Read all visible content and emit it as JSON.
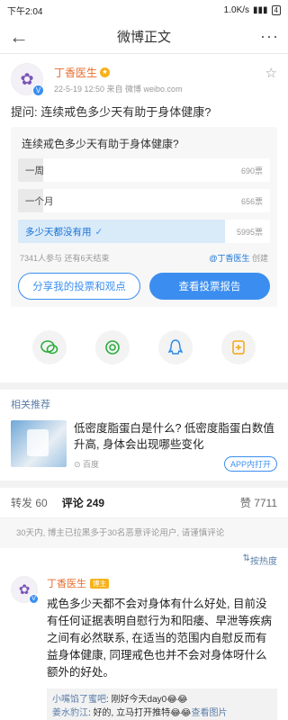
{
  "status_bar": {
    "time": "下午2:04",
    "speed": "1.0K/s",
    "battery": "4"
  },
  "nav": {
    "back_icon": "←",
    "title": "微博正文",
    "more_icon": "···"
  },
  "post": {
    "author": "丁香医生",
    "meta": "22-5-19 12:50  来自 微博 weibo.com",
    "question": "提问: 连续戒色多少天有助于身体健康?"
  },
  "poll": {
    "title": "连续戒色多少天有助于身体健康?",
    "options": [
      {
        "label": "一周",
        "votes": "690票",
        "share": 0.1
      },
      {
        "label": "一个月",
        "votes": "656票",
        "share": 0.1
      },
      {
        "label": "多少天都没有用",
        "votes": "5995票",
        "share": 0.82
      }
    ],
    "participants": "7341人参与  还有6天结束",
    "creator_prefix": "@",
    "creator_name": "丁香医生",
    "creator_suffix": " 创建",
    "share_btn": "分享我的投票和观点",
    "report_btn": "查看投票报告"
  },
  "related": {
    "title": "相关推荐",
    "headline": "低密度脂蛋白是什么? 低密度脂蛋白数值升高, 身体会出现哪些变化",
    "source": "百度",
    "app_btn": "APP内打开"
  },
  "tabs": {
    "repost": "转发 60",
    "comment": "评论 249",
    "likes": "赞 7711"
  },
  "notice": "30天内, 博主已拉黑多于30名恶意评论用户, 请谨慎评论",
  "sort_label": "按热度",
  "comment": {
    "author": "丁香医生",
    "tag": "博主",
    "text": "戒色多少天都不会对身体有什么好处, 目前没有任何证据表明自慰行为和阳痿、早泄等疾病之间有必然联系, 在适当的范围内自慰反而有益身体健康, 同理戒色也并不会对身体呀什么额外的好处。",
    "replies": [
      {
        "name": "小嘴馅了蜜吧",
        "text": ": 刚好今天day0😂😂"
      },
      {
        "name": "姜水豹江",
        "text": ": 好的, 立马打开推特😂😂",
        "extra": "查看图片"
      }
    ]
  }
}
